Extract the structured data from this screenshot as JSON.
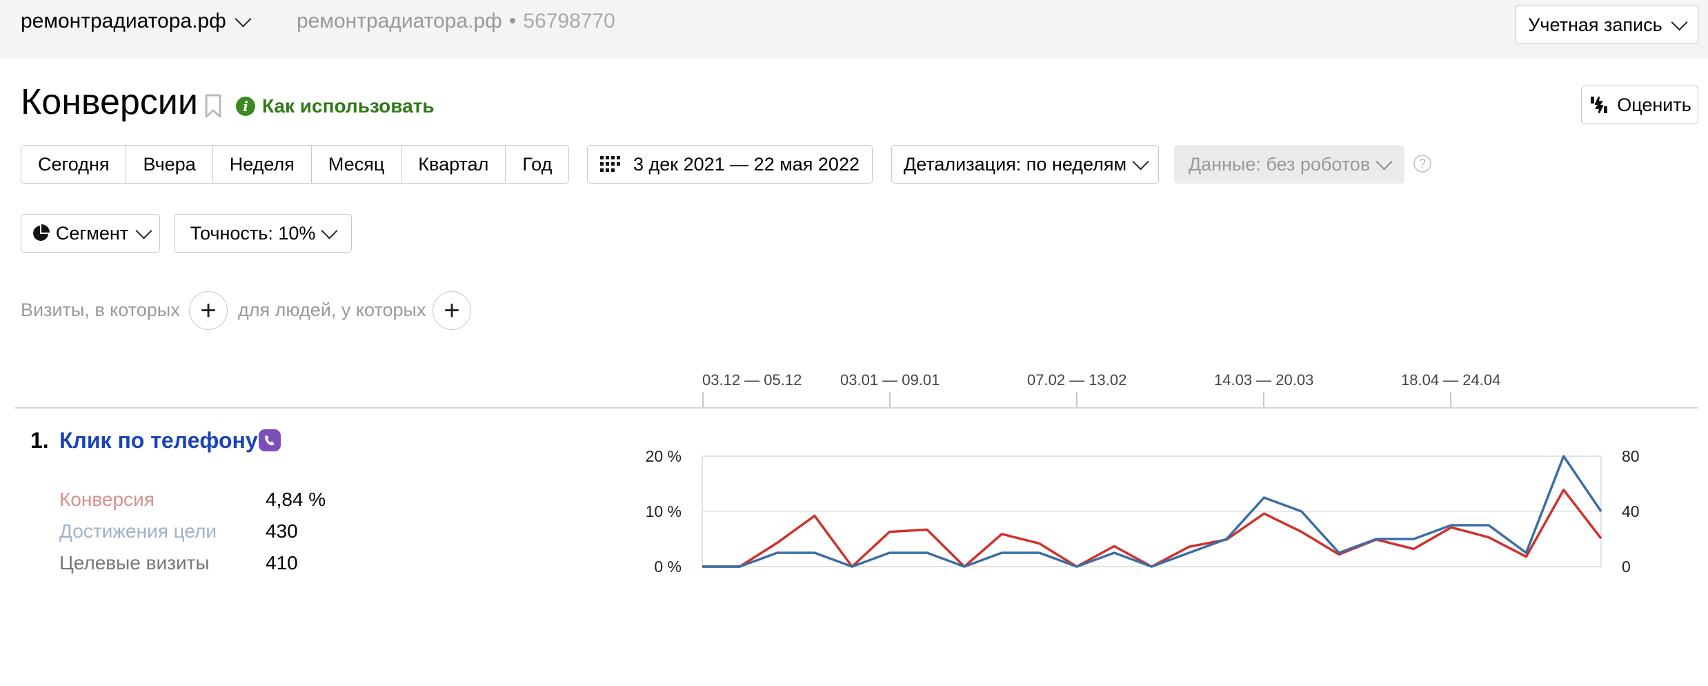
{
  "topbar": {
    "site_name": "ремонтрадиатора.рф",
    "crumb_site": "ремонтрадиатора.рф",
    "crumb_sep": "•",
    "counter_id": "56798770",
    "account_label": "Учетная запись"
  },
  "header": {
    "title": "Конверсии",
    "howto_label": "Как использовать",
    "rate_label": "Оценить"
  },
  "toolbar": {
    "periods": [
      "Сегодня",
      "Вчера",
      "Неделя",
      "Месяц",
      "Квартал",
      "Год"
    ],
    "date_range": "3 дек 2021 — 22 мая 2022",
    "detail_label": "Детализация: по неделям",
    "data_label": "Данные: без роботов",
    "help": "?",
    "segment_label": "Сегмент",
    "accuracy_label": "Точность: 10%"
  },
  "filters": {
    "visits_label": "Визиты, в которых",
    "people_label": "для людей, у которых",
    "plus": "+"
  },
  "timeline": [
    "03.12 — 05.12",
    "03.01 — 09.01",
    "07.02 — 13.02",
    "14.03 — 20.03",
    "18.04 — 24.04"
  ],
  "goal": {
    "index": "1.",
    "name": "Клик по телефону",
    "metrics": [
      {
        "label": "Конверсия",
        "value": "4,84 %",
        "color": "#d98f8f"
      },
      {
        "label": "Достижения цели",
        "value": "430",
        "color": "#9fb3c8"
      },
      {
        "label": "Целевые визиты",
        "value": "410",
        "color": "#777777"
      }
    ]
  },
  "chart_data": {
    "type": "line",
    "y_left_ticks": [
      "20 %",
      "10 %",
      "0 %"
    ],
    "y_right_ticks": [
      "80",
      "40",
      "0"
    ],
    "ylim_left": [
      0,
      20
    ],
    "ylim_right": [
      0,
      80
    ],
    "series": [
      {
        "axis": "left",
        "color": "#d0312d",
        "values": [
          0,
          0,
          4.3,
          9.2,
          0,
          6.3,
          6.7,
          0,
          5.9,
          4.2,
          0,
          3.7,
          0,
          3.6,
          4.9,
          9.6,
          6.3,
          2.2,
          4.9,
          3.2,
          7.1,
          5.3,
          1.8,
          13.9,
          5.1
        ]
      },
      {
        "axis": "right",
        "color": "#3a6ea5",
        "values": [
          0,
          0,
          10,
          10,
          0,
          10,
          10,
          0,
          10,
          10,
          0,
          10,
          0,
          10,
          20,
          50,
          40,
          10,
          20,
          20,
          30,
          30,
          10,
          80,
          40
        ]
      }
    ]
  },
  "colors": {
    "brand_green": "#2f7a17",
    "link_blue": "#1a44b8",
    "conversion_red": "#d0312d",
    "goals_blue": "#3a6ea5"
  },
  "icons": {
    "site_chevron": "chevron-down-icon",
    "bookmark": "bookmark-icon",
    "info": "info-icon",
    "rate": "thumbs-icon",
    "calendar": "calendar-icon",
    "segment": "pie-chart-icon",
    "viber": "viber-icon"
  }
}
